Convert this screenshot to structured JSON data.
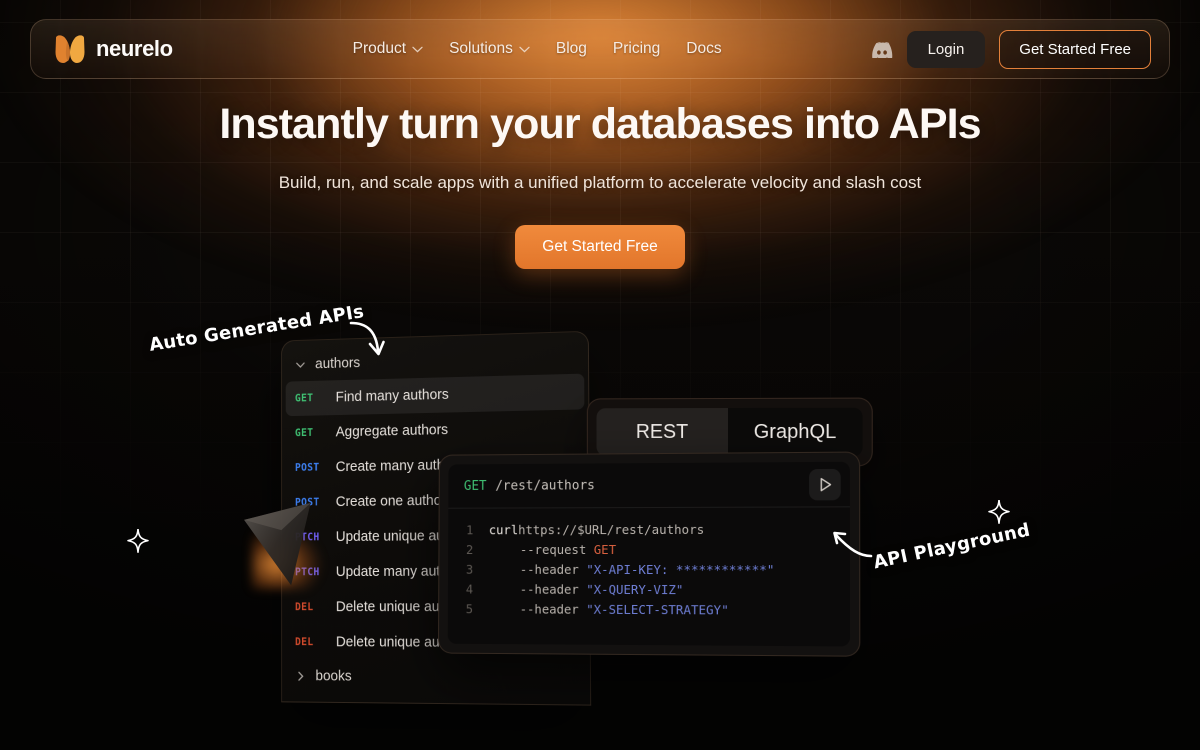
{
  "theme": {
    "accent": "#e2762b",
    "accent_light": "#f08a3c",
    "bg": "#070605",
    "text": "#fdf8f4"
  },
  "nav": {
    "brand": {
      "name": "neurelo",
      "logo_icon": "neurelo-logo-icon"
    },
    "links": [
      {
        "label": "Product",
        "has_dropdown": true
      },
      {
        "label": "Solutions",
        "has_dropdown": true
      },
      {
        "label": "Blog",
        "has_dropdown": false
      },
      {
        "label": "Pricing",
        "has_dropdown": false
      },
      {
        "label": "Docs",
        "has_dropdown": false
      }
    ],
    "discord_icon": "discord-icon",
    "login_label": "Login",
    "cta_label": "Get Started Free"
  },
  "hero": {
    "title": "Instantly turn your databases into APIs",
    "subtitle": "Build, run, and scale apps with a unified platform to accelerate velocity and slash cost",
    "cta_label": "Get Started Free"
  },
  "annotations": [
    {
      "id": "auto-generated-apis",
      "text": "Auto Generated APIs"
    },
    {
      "id": "api-playground",
      "text": "API Playground"
    }
  ],
  "endpoints_panel": {
    "groups": [
      {
        "name": "authors",
        "expanded": true,
        "caret": "chevron-down-icon"
      },
      {
        "name": "books",
        "expanded": false,
        "caret": "chevron-right-icon"
      }
    ],
    "endpoints": [
      {
        "method": "GET",
        "label": "Find many authors",
        "active": true
      },
      {
        "method": "GET",
        "label": "Aggregate authors",
        "active": false
      },
      {
        "method": "POST",
        "label": "Create many authors",
        "active": false
      },
      {
        "method": "POST",
        "label": "Create one author",
        "active": false
      },
      {
        "method": "PTCH",
        "label": "Update unique author",
        "active": false
      },
      {
        "method": "PTCH",
        "label": "Update many authors",
        "active": false
      },
      {
        "method": "DEL",
        "label": "Delete unique author",
        "active": false
      },
      {
        "method": "DEL",
        "label": "Delete unique author",
        "active": false
      }
    ],
    "method_colors": {
      "GET": "#3fbf72",
      "POST": "#3d7ff0",
      "PTCH": "#6d5ef0",
      "DEL": "#cf4a2c"
    }
  },
  "api_tabs": {
    "tabs": [
      {
        "label": "REST",
        "active": true
      },
      {
        "label": "GraphQL",
        "active": false
      }
    ]
  },
  "playground": {
    "method": "GET",
    "path": "/rest/authors",
    "run_icon": "play-icon",
    "code_lines": [
      {
        "n": "1",
        "indent": 0,
        "cmd": "curl",
        "rest": " https://$URL/rest/authors"
      },
      {
        "n": "2",
        "indent": 1,
        "flag": "--request",
        "verb": "GET"
      },
      {
        "n": "3",
        "indent": 1,
        "flag": "--header",
        "str": "\"X-API-KEY: ************\""
      },
      {
        "n": "4",
        "indent": 1,
        "flag": "--header",
        "str": "\"X-QUERY-VIZ\""
      },
      {
        "n": "5",
        "indent": 1,
        "flag": "--header",
        "str": "\"X-SELECT-STRATEGY\""
      }
    ]
  }
}
